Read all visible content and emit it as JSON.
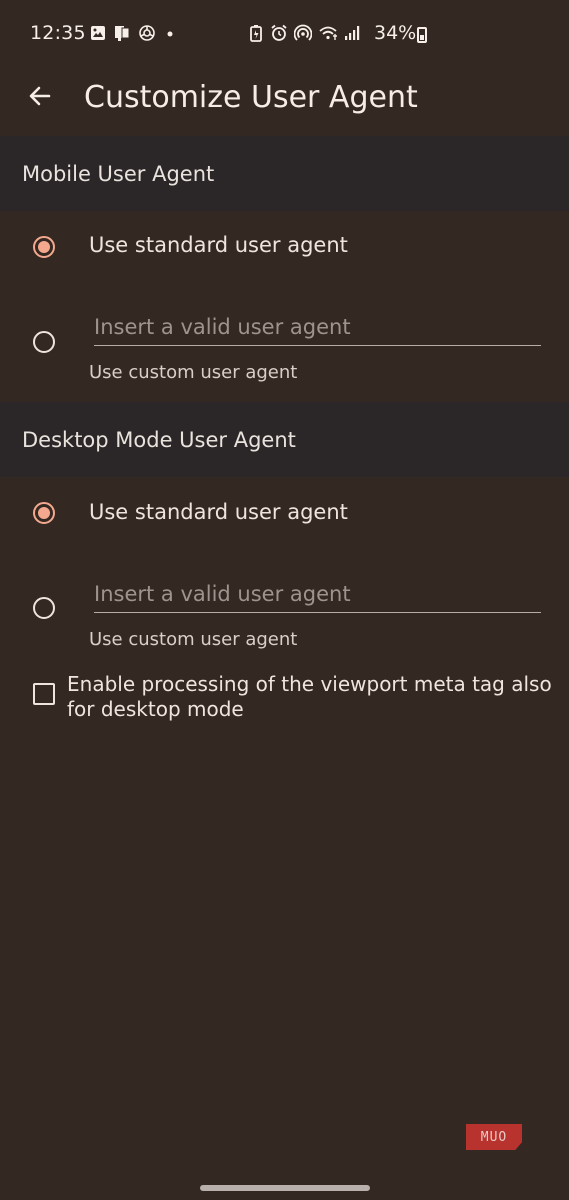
{
  "status_bar": {
    "time": "12:35",
    "battery": "34%",
    "left_icons": [
      "image-icon",
      "notes-icon",
      "openai-icon",
      "dot-icon"
    ],
    "right_icons": [
      "battery-saver-icon",
      "alarm-icon",
      "hotspot-icon",
      "wifi-icon",
      "signal-icon"
    ]
  },
  "app_bar": {
    "title": "Customize User Agent",
    "back_icon": "arrow-left-icon"
  },
  "sections": [
    {
      "header": "Mobile User Agent",
      "standard_label": "Use standard user agent",
      "standard_selected": true,
      "custom_placeholder": "Insert a valid user agent",
      "custom_value": "",
      "custom_label": "Use custom user agent",
      "custom_selected": false
    },
    {
      "header": "Desktop Mode User Agent",
      "standard_label": "Use standard user agent",
      "standard_selected": true,
      "custom_placeholder": "Insert a valid user agent",
      "custom_value": "",
      "custom_label": "Use custom user agent",
      "custom_selected": false
    }
  ],
  "viewport_option": {
    "label": "Enable processing of the viewport meta tag also for desktop mode",
    "checked": false
  },
  "watermark": {
    "text": "MUO"
  },
  "colors": {
    "background": "#342822",
    "section_header": "#2b2728",
    "accent": "#f4a98f",
    "text": "#efe5df"
  }
}
